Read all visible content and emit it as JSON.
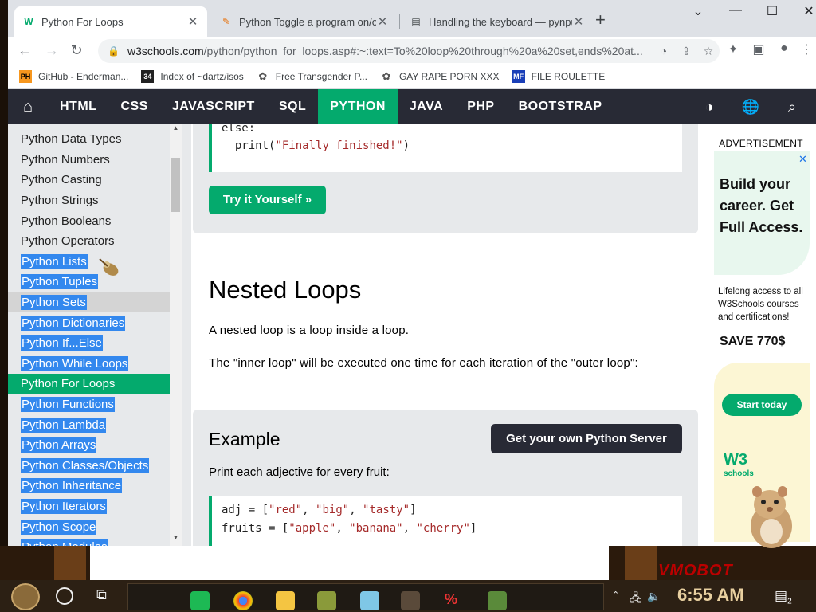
{
  "browser": {
    "tabs": [
      {
        "title": "Python For Loops",
        "favicon": "W",
        "active": true
      },
      {
        "title": "Python Toggle a program on/off",
        "favicon": "✎",
        "active": false
      },
      {
        "title": "Handling the keyboard — pynput",
        "favicon": "▤",
        "active": false
      }
    ],
    "url_host": "w3schools.com",
    "url_path": "/python/python_for_loops.asp#:~:text=To%20loop%20through%20a%20set,ends%20at...",
    "bookmarks": [
      {
        "label": "GitHub - Enderman...",
        "icon": "PH"
      },
      {
        "label": "Index of ~dartz/isos",
        "icon": "34"
      },
      {
        "label": "Free Transgender P...",
        "icon": "✿"
      },
      {
        "label": "GAY RAPE PORN XXX",
        "icon": "✿"
      },
      {
        "label": "FILE ROULETTE",
        "icon": "MF"
      }
    ]
  },
  "w3nav": {
    "items": [
      "HTML",
      "CSS",
      "JAVASCRIPT",
      "SQL",
      "PYTHON",
      "JAVA",
      "PHP",
      "BOOTSTRAP"
    ],
    "active": "PYTHON"
  },
  "sidebar": {
    "items": [
      {
        "label": "Python Data Types",
        "state": "normal"
      },
      {
        "label": "Python Numbers",
        "state": "normal"
      },
      {
        "label": "Python Casting",
        "state": "normal"
      },
      {
        "label": "Python Strings",
        "state": "normal"
      },
      {
        "label": "Python Booleans",
        "state": "normal"
      },
      {
        "label": "Python Operators",
        "state": "normal"
      },
      {
        "label": "Python Lists",
        "state": "selected"
      },
      {
        "label": "Python Tuples",
        "state": "selected"
      },
      {
        "label": "Python Sets",
        "state": "selected-grey"
      },
      {
        "label": "Python Dictionaries",
        "state": "selected"
      },
      {
        "label": "Python If...Else",
        "state": "selected"
      },
      {
        "label": "Python While Loops",
        "state": "selected"
      },
      {
        "label": "Python For Loops",
        "state": "current"
      },
      {
        "label": "Python Functions",
        "state": "selected"
      },
      {
        "label": "Python Lambda",
        "state": "selected"
      },
      {
        "label": "Python Arrays",
        "state": "selected"
      },
      {
        "label": "Python Classes/Objects",
        "state": "selected"
      },
      {
        "label": "Python Inheritance",
        "state": "selected"
      },
      {
        "label": "Python Iterators",
        "state": "selected"
      },
      {
        "label": "Python Scope",
        "state": "selected"
      },
      {
        "label": "Python Modules",
        "state": "selected"
      }
    ]
  },
  "main": {
    "code_top": [
      {
        "plain": "else:",
        "str": ""
      },
      {
        "plain": "  print(",
        "str": "\"Finally finished!\"",
        "tail": ")"
      }
    ],
    "try_button": "Try it Yourself »",
    "heading": "Nested Loops",
    "para1": "A nested loop is a loop inside a loop.",
    "para2": "The \"inner loop\" will be executed one time for each iteration of the \"outer loop\":",
    "example_title": "Example",
    "server_button": "Get your own Python Server",
    "example_desc": "Print each adjective for every fruit:",
    "code_bottom": [
      {
        "prefix": "adj = [",
        "items": [
          "\"red\"",
          "\"big\"",
          "\"tasty\""
        ],
        "suffix": "]"
      },
      {
        "prefix": "fruits = [",
        "items": [
          "\"apple\"",
          "\"banana\"",
          "\"cherry\""
        ],
        "suffix": "]"
      }
    ]
  },
  "ad": {
    "label": "ADVERTISEMENT",
    "headline": "Build your career. Get Full Access.",
    "sub": "Lifelong access to all W3Schools courses and certifications!",
    "save": "SAVE 770$",
    "button": "Start today",
    "logo": "W3",
    "logo_sub": "schools"
  },
  "taskbar": {
    "clock": "6:55 AM",
    "notifications": "2"
  },
  "desktop": {
    "text": "VMOBOT"
  },
  "colors": {
    "w3_green": "#04aa6d",
    "w3_dark": "#282a35",
    "selection_blue": "#3388ee",
    "string_red": "#a52a2a"
  }
}
